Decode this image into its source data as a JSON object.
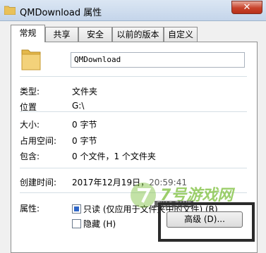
{
  "window": {
    "title": "QMDownload 属性",
    "close_icon": "close-icon"
  },
  "tabs": [
    {
      "label": "常规",
      "active": true
    },
    {
      "label": "共享",
      "active": false
    },
    {
      "label": "安全",
      "active": false
    },
    {
      "label": "以前的版本",
      "active": false
    },
    {
      "label": "自定义",
      "active": false
    }
  ],
  "general": {
    "folder_icon": "folder-icon",
    "name_value": "QMDownload",
    "type": {
      "label": "类型:",
      "value": "文件夹"
    },
    "location": {
      "label": "位置",
      "value": "G:\\"
    },
    "size": {
      "label": "大小:",
      "value": "0 字节"
    },
    "size_on_disk": {
      "label": "占用空间:",
      "value": "0 字节"
    },
    "contains": {
      "label": "包含:",
      "value": "0 个文件，1 个文件夹"
    },
    "created": {
      "label": "创建时间:",
      "date": "2017年12月19日，",
      "time": "20:59:41"
    },
    "attributes": {
      "label": "属性:",
      "readonly_label": "只读 (仅应用于文件夹中的文件) (R)",
      "hidden_label": "隐藏 (H)",
      "advanced_button": "高级 (D)..."
    }
  },
  "watermark": {
    "text": "7号游戏网",
    "sub": "7HAO GAME"
  },
  "colors": {
    "accent": "#2f66c7",
    "watermark": "#7cbf3a",
    "close": "#c8432b"
  }
}
